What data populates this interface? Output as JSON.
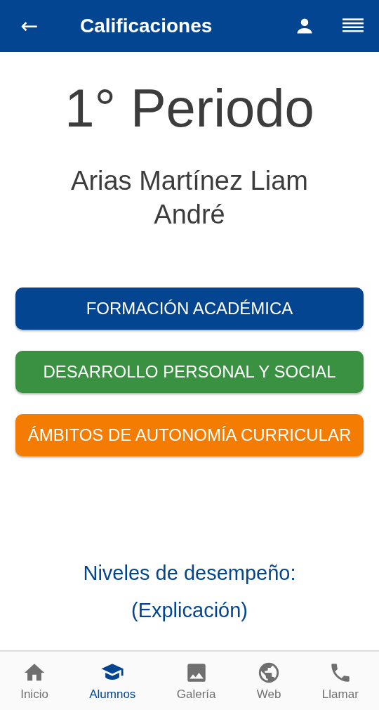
{
  "header": {
    "back": "←",
    "title": "Calificaciones"
  },
  "period": "1° Periodo",
  "student": "Arias Martínez Liam André",
  "categories": [
    {
      "label": "FORMACIÓN ACADÉMICA",
      "color": "#034590"
    },
    {
      "label": "DESARROLLO PERSONAL Y SOCIAL",
      "color": "#3a9142"
    },
    {
      "label": "ÁMBITOS DE AUTONOMÍA CURRICULAR",
      "color": "#f47c03"
    }
  ],
  "levels_link": {
    "title": "Niveles de desempeño:",
    "link": "(Explicación)"
  },
  "nav": [
    {
      "kind": "home",
      "label": "Inicio",
      "selected": false
    },
    {
      "kind": "students",
      "label": "Alumnos",
      "selected": true
    },
    {
      "kind": "gallery",
      "label": "Galería",
      "selected": false
    },
    {
      "kind": "web",
      "label": "Web",
      "selected": false
    },
    {
      "kind": "phone",
      "label": "Llamar",
      "selected": false
    }
  ]
}
